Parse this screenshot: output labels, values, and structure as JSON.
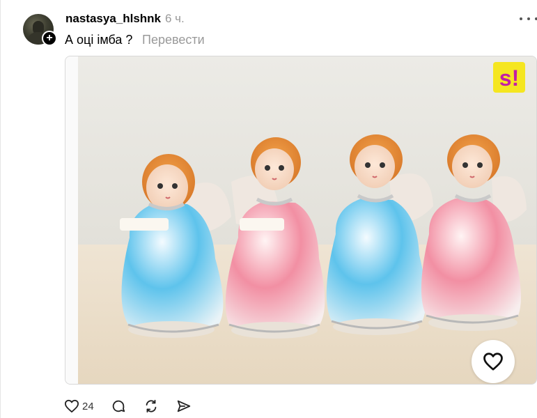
{
  "post": {
    "username": "nastasya_hlshnk",
    "timestamp": "6 ч.",
    "text": "А оці імба ?",
    "translate_label": "Перевести"
  },
  "media": {
    "watermark": "s!",
    "description_icon": "angel-figurines-photo"
  },
  "actions": {
    "like_count": "24",
    "icons": [
      "heart-icon",
      "comment-icon",
      "repost-icon",
      "share-icon"
    ]
  },
  "colors": {
    "text": "#000000",
    "muted": "#999999",
    "watermark_bg": "#f5e620",
    "watermark_fg": "#c21ea6"
  }
}
